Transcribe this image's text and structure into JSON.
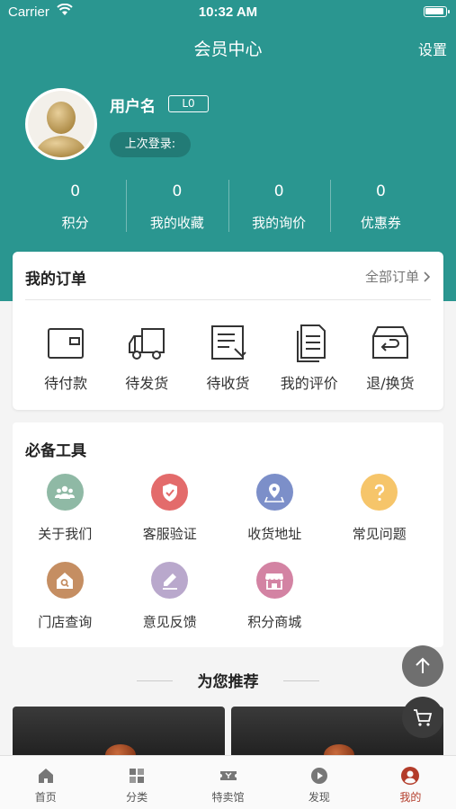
{
  "status_bar": {
    "carrier": "Carrier",
    "time": "10:32 AM"
  },
  "nav": {
    "title": "会员中心",
    "settings": "设置"
  },
  "profile": {
    "username": "用户名",
    "level": "L0",
    "last_login": "上次登录:"
  },
  "stats": [
    {
      "value": "0",
      "label": "积分"
    },
    {
      "value": "0",
      "label": "我的收藏"
    },
    {
      "value": "0",
      "label": "我的询价"
    },
    {
      "value": "0",
      "label": "优惠券"
    }
  ],
  "orders": {
    "title": "我的订单",
    "all_label": "全部订单",
    "items": [
      {
        "label": "待付款",
        "icon": "wallet-icon"
      },
      {
        "label": "待发货",
        "icon": "truck-icon"
      },
      {
        "label": "待收货",
        "icon": "receipt-icon"
      },
      {
        "label": "我的评价",
        "icon": "document-icon"
      },
      {
        "label": "退/换货",
        "icon": "return-box-icon"
      }
    ]
  },
  "tools": {
    "title": "必备工具",
    "items": [
      {
        "label": "关于我们",
        "icon": "group-icon",
        "color": "#8fb9a5"
      },
      {
        "label": "客服验证",
        "icon": "shield-check-icon",
        "color": "#e36b6b"
      },
      {
        "label": "收货地址",
        "icon": "location-pin-icon",
        "color": "#7c8fc9"
      },
      {
        "label": "常见问题",
        "icon": "question-icon",
        "color": "#f6c56a"
      },
      {
        "label": "门店查询",
        "icon": "store-search-icon",
        "color": "#c58e62"
      },
      {
        "label": "意见反馈",
        "icon": "pencil-icon",
        "color": "#b9a8cc"
      },
      {
        "label": "积分商城",
        "icon": "shop-icon",
        "color": "#d383a3"
      }
    ]
  },
  "recommend": {
    "title": "为您推荐"
  },
  "tabs": [
    {
      "label": "首页",
      "icon": "home-icon"
    },
    {
      "label": "分类",
      "icon": "category-icon"
    },
    {
      "label": "特卖馆",
      "icon": "ticket-icon"
    },
    {
      "label": "发现",
      "icon": "play-icon"
    },
    {
      "label": "我的",
      "icon": "user-icon",
      "active": true
    }
  ],
  "colors": {
    "brand": "#2a9690",
    "active_tab": "#b33c2a"
  }
}
